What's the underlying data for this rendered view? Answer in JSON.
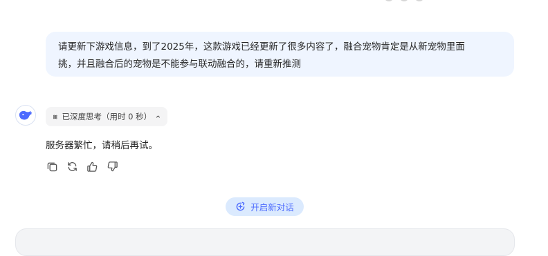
{
  "user_message": {
    "line1": "请更新下游戏信息，到了2025年，这款游戏已经更新了很多内容了，融合宠物肯定是从新宠物里面",
    "line2": "挑，并且融合后的宠物是不能参与联动融合的，请重新推测"
  },
  "assistant": {
    "avatar_icon": "deepseek-whale-icon",
    "thinking_label": "已深度思考（用时 0 秒）",
    "thinking_icon": "atom-icon",
    "toggle_icon": "chevron-up-icon",
    "reply": "服务器繁忙，请稍后再试。",
    "actions": [
      "copy-icon",
      "regenerate-icon",
      "thumbs-up-icon",
      "thumbs-down-icon"
    ]
  },
  "new_chat": {
    "label": "开启新对话",
    "icon": "new-chat-icon"
  },
  "colors": {
    "accent": "#4d6bfe",
    "user_bubble_bg": "#eff5ff",
    "new_chat_bg": "#dbeafe"
  }
}
